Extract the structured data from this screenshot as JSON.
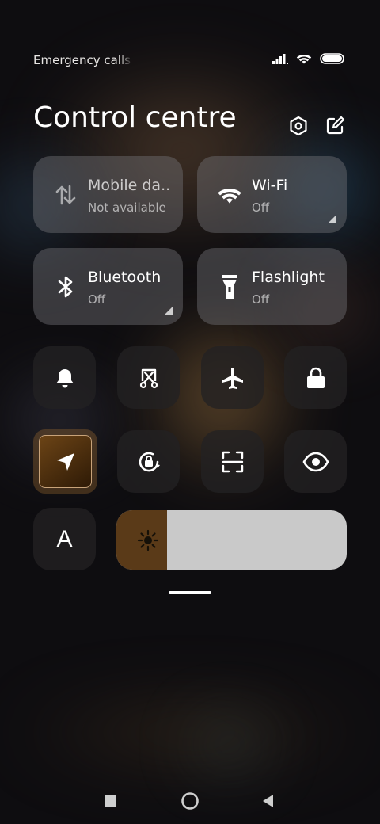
{
  "status_bar": {
    "carrier_text": "Emergency calls o",
    "icons": [
      "signal-icon",
      "wifi-icon",
      "battery-icon"
    ]
  },
  "header": {
    "title": "Control centre",
    "icons": [
      "settings-icon",
      "edit-icon"
    ]
  },
  "tiles": [
    {
      "name": "Mobile da..",
      "status": "Not available",
      "icon": "mobile-data-icon"
    },
    {
      "name": "Wi-Fi",
      "status": "Off",
      "icon": "wifi-icon"
    },
    {
      "name": "Bluetooth",
      "status": "Off",
      "icon": "bluetooth-icon"
    },
    {
      "name": "Flashlight",
      "status": "Off",
      "icon": "flashlight-icon"
    }
  ],
  "toggles_row1": [
    "bell-icon",
    "screenshot-icon",
    "airplane-icon",
    "lock-icon"
  ],
  "toggles_row2": [
    "location-icon",
    "rotation-lock-icon",
    "scan-icon",
    "eye-icon"
  ],
  "font_toggle": {
    "label": "A"
  },
  "brightness": {
    "level": 0.22,
    "icon": "sun-icon"
  },
  "colors": {
    "accent": "#6c4416",
    "tile": "#78787d"
  },
  "nav_bar": [
    "recents-icon",
    "home-icon",
    "back-icon"
  ]
}
